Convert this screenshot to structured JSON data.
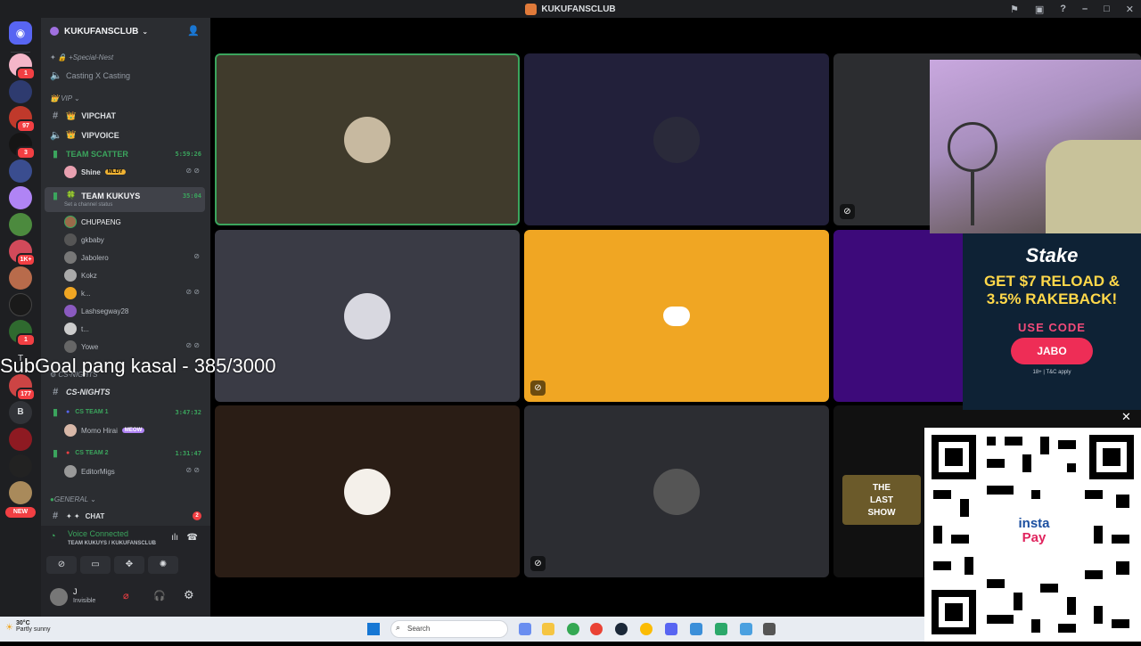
{
  "window": {
    "title": "KUKUFANSCLUB"
  },
  "server": {
    "name": "KUKUFANSCLUB"
  },
  "rail_badges": [
    "1",
    "97",
    "3",
    "1",
    "1K+",
    "1",
    "177"
  ],
  "rail_letters": {
    "t": "T",
    "b": "B"
  },
  "rail_new_label": "NEW",
  "channels": {
    "special_nest": "+Special-Nest",
    "casting": "Casting X Casting",
    "vip_category": "VIP",
    "vipchat": "VIPCHAT",
    "vipvoice": "VIPVOICE",
    "team_scatter": "TEAM SCATTER",
    "team_scatter_time": "5:59:26",
    "shine": "Shine",
    "shine_tag": "MLDY",
    "team_kukuys": "TEAM KUKUYS",
    "team_kukuys_time": "35:04",
    "set_status": "Set a channel status",
    "cs_nights_cat": "CS-NIGHTS",
    "cs_nights": "CS-NIGHTS",
    "cs_team1": "CS TEAM 1",
    "cs_team1_time": "3:47:32",
    "momo": "Momo Hirai",
    "momo_tag": "MEOW",
    "cs_team2": "CS TEAM 2",
    "cs_team2_time": "1:31:47",
    "editormigs": "EditorMigs",
    "general_cat": "GENERAL",
    "chat": "CHAT",
    "chat_badge": "2"
  },
  "members": [
    "CHUPAENG",
    "gkbaby",
    "Jabolero",
    "Kokz",
    "k...",
    "Lashsegway28",
    "t...",
    "Yowe"
  ],
  "overlay": {
    "subgoal": "SubGoal pang kasal - 385/3000"
  },
  "voice": {
    "status": "Voice Connected",
    "location": "TEAM KUKUYS / KUKUFANSCLUB"
  },
  "user": {
    "name": "J",
    "status": "Invisible"
  },
  "ad": {
    "brand": "Stake",
    "headline_1": "GET $7 RELOAD &",
    "headline_2": "3.5% RAKEBACK!",
    "use_code": "USE CODE",
    "code": "JABO",
    "fine_print": "18+ | T&C apply"
  },
  "qr": {
    "label_1": "insta",
    "label_2": "Pay"
  },
  "tile_thumbnail": {
    "line1": "THE",
    "line2": "LAST",
    "line3": "SHOW"
  },
  "taskbar": {
    "temperature": "30°C",
    "weather": "Partly sunny",
    "search_placeholder": "Search"
  },
  "colors": {
    "accent_green": "#3ba55d",
    "discord_blurple": "#5865f2",
    "tile_yellow": "#f0a623",
    "tile_purple": "#3d0a7a"
  }
}
